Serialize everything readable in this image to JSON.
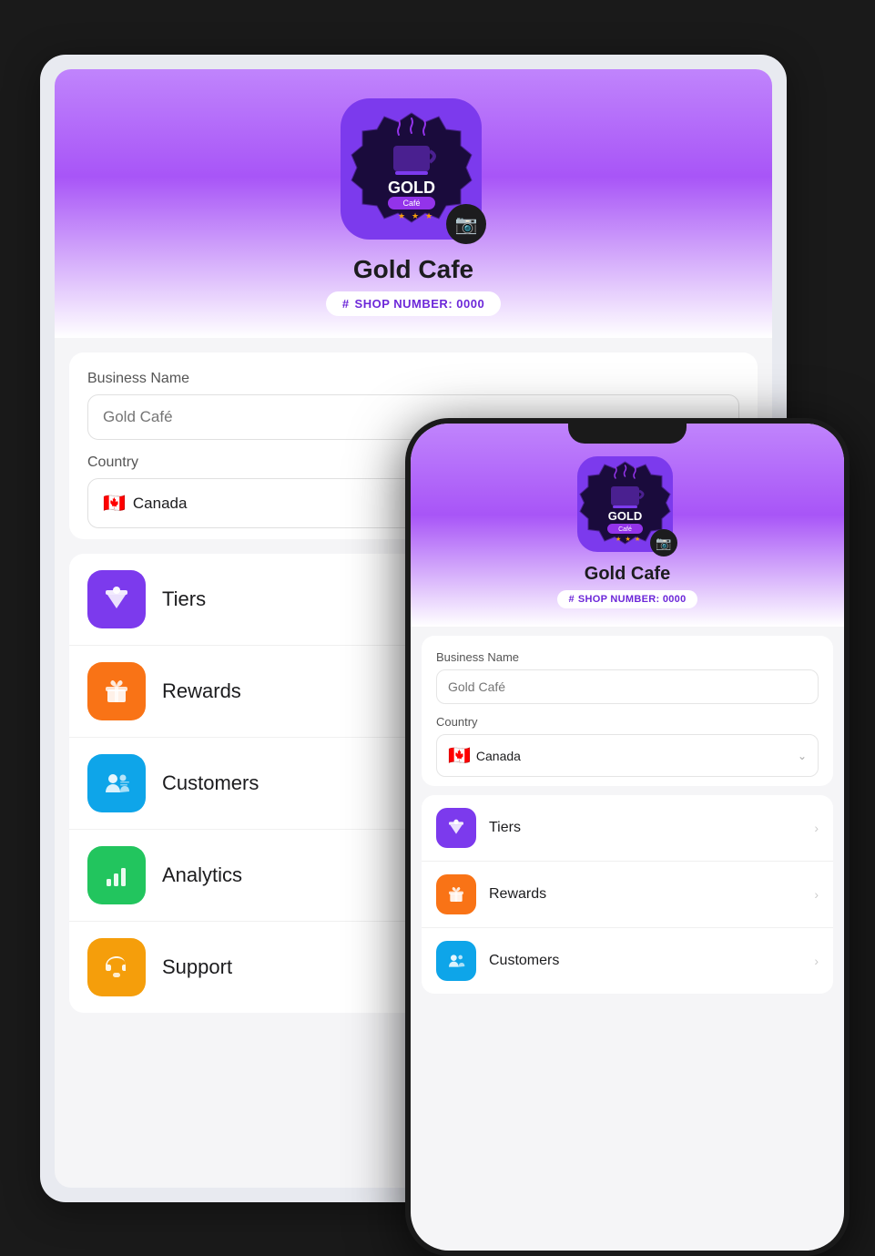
{
  "app": {
    "shop_name": "Gold Cafe",
    "shop_number_label": "SHOP NUMBER: 0000",
    "business_name_label": "Business Name",
    "business_name_placeholder": "Gold Café",
    "country_label": "Country",
    "country_value": "Canada",
    "country_flag": "🇨🇦"
  },
  "menu_items": [
    {
      "id": "tiers",
      "label": "Tiers",
      "icon_color": "icon-purple",
      "icon": "👑"
    },
    {
      "id": "rewards",
      "label": "Rewards",
      "icon_color": "icon-orange",
      "icon": "🎁"
    },
    {
      "id": "customers",
      "label": "Customers",
      "icon_color": "icon-blue",
      "icon": "👤"
    },
    {
      "id": "analytics",
      "label": "Analytics",
      "icon_color": "icon-green",
      "icon": "📊"
    },
    {
      "id": "support",
      "label": "Support",
      "icon_color": "icon-amber",
      "icon": "🎧"
    }
  ],
  "phone_menu_items": [
    {
      "id": "tiers",
      "label": "Tiers",
      "icon_color": "icon-purple",
      "icon": "👑"
    },
    {
      "id": "rewards",
      "label": "Rewards",
      "icon_color": "icon-orange",
      "icon": "🎁"
    },
    {
      "id": "customers",
      "label": "Customers",
      "icon_color": "icon-blue",
      "icon": "👤"
    }
  ],
  "icons": {
    "camera": "📷",
    "hash": "#",
    "chevron": "›"
  }
}
